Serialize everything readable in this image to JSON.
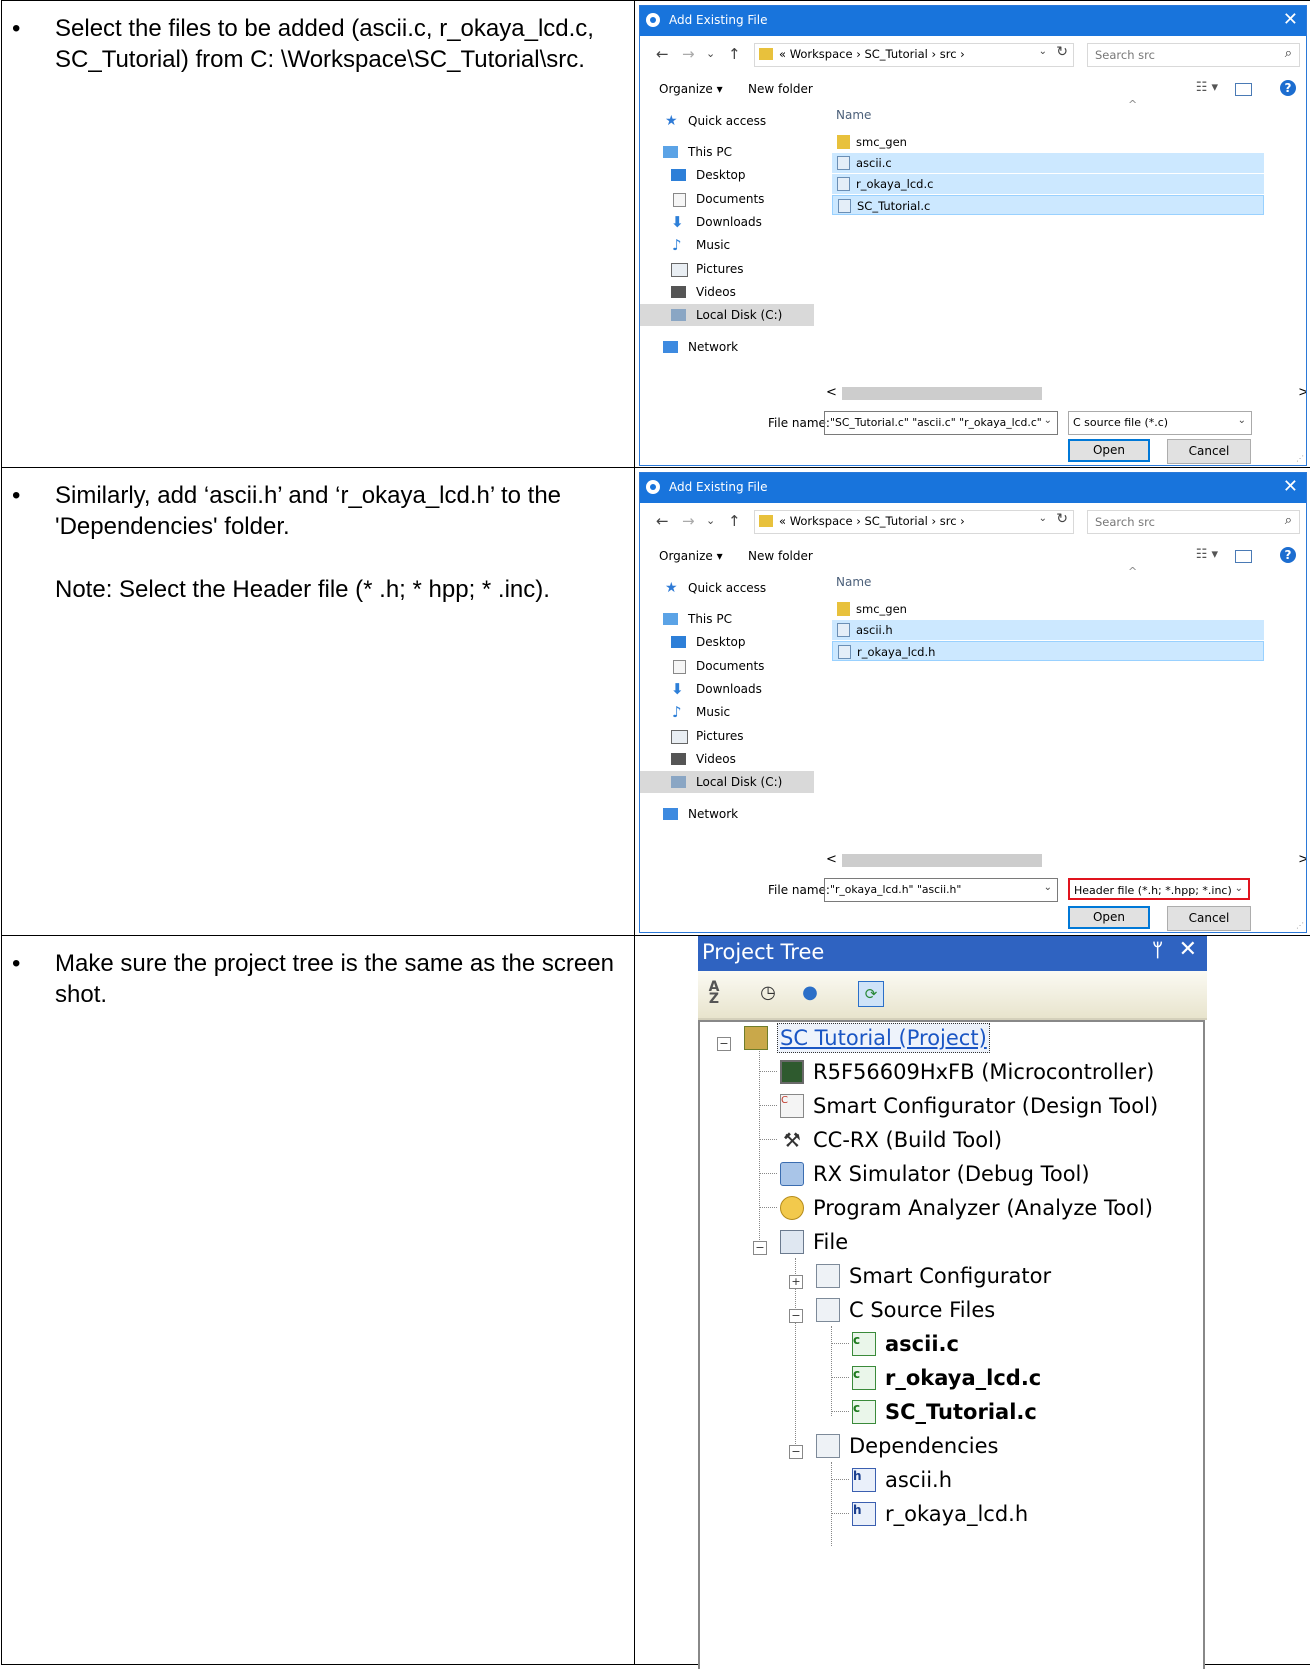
{
  "rows": [
    {
      "bullet": "•",
      "text": "Select the files to be added (ascii.c, r_okaya_lcd.c, SC_Tutorial) from C: \\Workspace\\SC_Tutorial\\src.",
      "note": ""
    },
    {
      "bullet": "•",
      "text": "Similarly, add ‘ascii.h’ and ‘r_okaya_lcd.h’ to the 'Dependencies' folder.",
      "note": "Note: Select the Header file (* .h; * hpp; * .inc)."
    },
    {
      "bullet": "•",
      "text": "Make sure the project tree is the same as the screen shot.",
      "note": ""
    }
  ],
  "dialog": {
    "title": "Add Existing File",
    "close_glyph": "✕",
    "back_glyph": "←",
    "forward_glyph": "→",
    "recent_glyph": "⌄",
    "up_glyph": "↑",
    "address_path": "«  Workspace  ›  SC_Tutorial  ›  src  ›",
    "refresh_glyph": "↻",
    "search_placeholder": "Search src",
    "organize_label": "Organize ▾",
    "new_folder_label": "New folder",
    "views_glyph": "☷ ▾",
    "help_glyph": "?",
    "column_name": "Name",
    "column_sort_glyph": "^",
    "nav_items": [
      "Quick access",
      "This PC",
      "Desktop",
      "Documents",
      "Downloads",
      "Music",
      "Pictures",
      "Videos",
      "Local Disk (C:)",
      "Network"
    ],
    "file_name_label": "File name:",
    "open_label": "Open",
    "cancel_label": "Cancel",
    "scroll_left": "<",
    "scroll_right": ">"
  },
  "dialog1": {
    "files": [
      "smc_gen",
      "ascii.c",
      "r_okaya_lcd.c",
      "SC_Tutorial.c"
    ],
    "file_name_value": "\"SC_Tutorial.c\" \"ascii.c\" \"r_okaya_lcd.c\"",
    "file_type_value": "C source file (*.c)"
  },
  "dialog2": {
    "files": [
      "smc_gen",
      "ascii.h",
      "r_okaya_lcd.h"
    ],
    "file_name_value": "\"r_okaya_lcd.h\" \"ascii.h\"",
    "file_type_value": "Header file (*.h; *.hpp; *.inc)"
  },
  "project_tree": {
    "title": "Project Tree",
    "pin_glyph": "ᛘ",
    "close_glyph": "✕",
    "nodes": [
      "SC Tutorial (Project)",
      "R5F56609HxFB (Microcontroller)",
      "Smart Configurator (Design Tool)",
      "CC-RX (Build Tool)",
      "RX Simulator (Debug Tool)",
      "Program Analyzer (Analyze Tool)",
      "File",
      "Smart Configurator",
      "C Source Files",
      "ascii.c",
      "r_okaya_lcd.c",
      "SC_Tutorial.c",
      "Dependencies",
      "ascii.h",
      "r_okaya_lcd.h"
    ]
  },
  "colors": {
    "dialog_title_bar": "#1874dc",
    "selection": "#cce8ff",
    "highlight_box": "#e0141e",
    "tree_header": "#2f63c1"
  }
}
